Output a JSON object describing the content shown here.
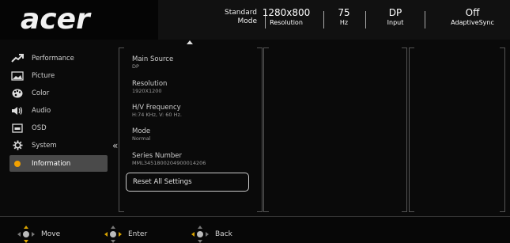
{
  "brand": {
    "logo_text": "acer"
  },
  "header": {
    "mode": {
      "value": "Standard",
      "label": "Mode"
    },
    "resolution": {
      "value": "1280x800",
      "label": "Resolution"
    },
    "refresh": {
      "value": "75",
      "label": "Hz"
    },
    "input": {
      "value": "DP",
      "label": "Input"
    },
    "adaptive": {
      "value": "Off",
      "label": "AdaptiveSync"
    }
  },
  "sidebar": {
    "items": [
      {
        "label": "Performance",
        "icon": "performance-icon"
      },
      {
        "label": "Picture",
        "icon": "picture-icon"
      },
      {
        "label": "Color",
        "icon": "color-palette-icon"
      },
      {
        "label": "Audio",
        "icon": "speaker-icon"
      },
      {
        "label": "OSD",
        "icon": "osd-icon"
      },
      {
        "label": "System",
        "icon": "gear-icon"
      },
      {
        "label": "Information",
        "icon": "info-dot-icon",
        "active": true
      }
    ]
  },
  "info": {
    "main_source": {
      "title": "Main Source",
      "value": "DP"
    },
    "resolution": {
      "title": "Resolution",
      "value": "1920X1200"
    },
    "hv_frequency": {
      "title": "H/V Frequency",
      "value": "H:74 KHz, V: 60 Hz."
    },
    "mode": {
      "title": "Mode",
      "value": "Normal"
    },
    "serial": {
      "title": "Series Number",
      "value": "MML3451800204900014206"
    },
    "reset_label": "Reset All Settings"
  },
  "footer": {
    "move": "Move",
    "enter": "Enter",
    "back": "Back"
  },
  "colors": {
    "accent": "#d8a300",
    "active_dot": "#f2a100",
    "active_bg": "#4a4a4a"
  }
}
